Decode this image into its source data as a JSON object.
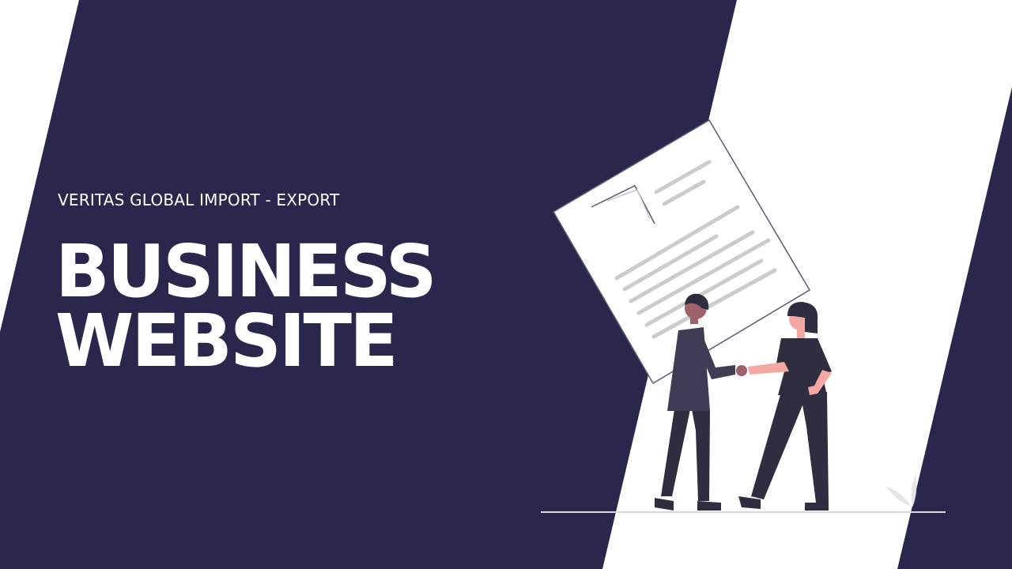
{
  "brand": {
    "subtitle": "VERITAS GLOBAL IMPORT - EXPORT"
  },
  "headline": {
    "line1": "BUSINESS",
    "line2": "WEBSITE"
  },
  "colors": {
    "navy": "#29284c",
    "white": "#ffffff",
    "skin": "#f4a8a1",
    "figure_dark": "#2f2e41",
    "jacket": "#3f3d56"
  },
  "illustration": {
    "icon": "business-handshake-illustration"
  }
}
